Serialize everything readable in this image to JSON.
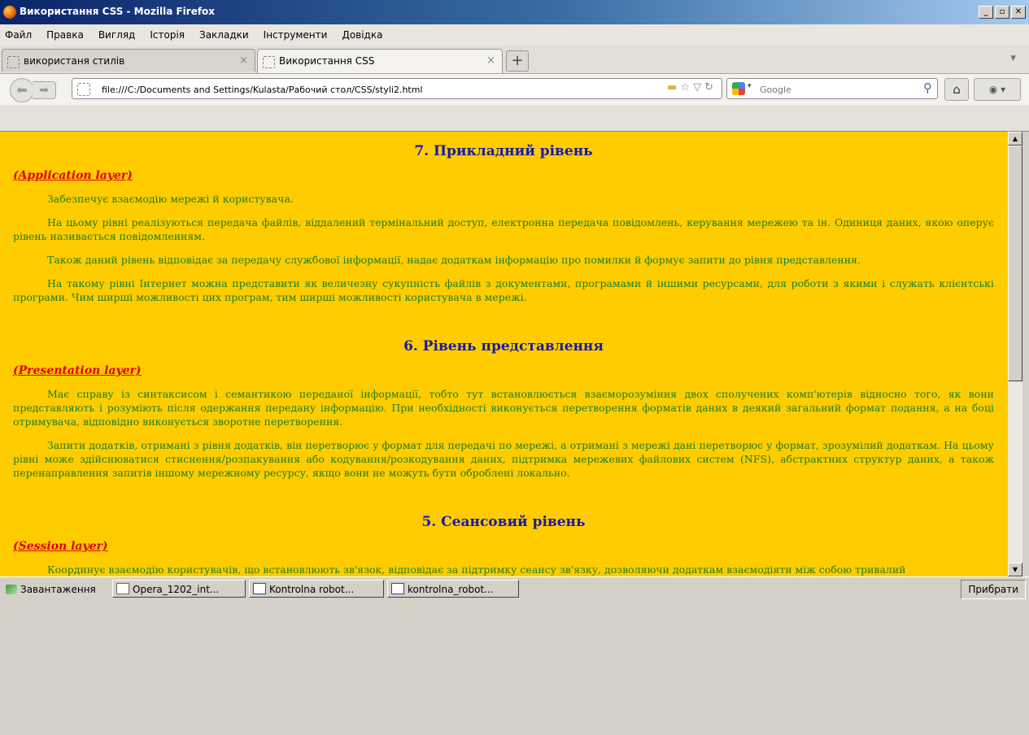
{
  "window": {
    "title": "Використання CSS - Mozilla Firefox",
    "controls": [
      "_",
      "▫",
      "✕"
    ]
  },
  "menu": [
    "Файл",
    "Правка",
    "Вигляд",
    "Історія",
    "Закладки",
    "Інструменти",
    "Довідка"
  ],
  "tabs": [
    {
      "label": "використаня стилів",
      "close": "×"
    },
    {
      "label": "Використання CSS",
      "close": "×"
    }
  ],
  "new_tab": "+",
  "address": {
    "url": "file:///C:/Documents and Settings/Kulasta/Рабочий стол/CSS/styli2.html"
  },
  "search": {
    "placeholder": "Google"
  },
  "content": {
    "sections": [
      {
        "heading": "7. Прикладний рівень",
        "layer": "(Application layer)",
        "paragraphs": [
          "Забезпечує взаємодію мережі й користувача.",
          "На цьому рівні реалізуються передача файлів, віддалений термінальний доступ, електронна передача повідомлень, керування мережею та ін. Одиниця даних, якою оперує рівень називається повідомленням.",
          "Також даний рівень відповідає за передачу службової інформації, надає додаткам інформацію про помилки й формує запити до рівня представлення.",
          "На такому рівні Інтернет можна представити як величезну сукупність файлів з документами, програмами й іншими ресурсами, для роботи з якими і служать клієнтські програми. Чим ширші можливості цих програм, тим ширші можливості користувача в мережі."
        ]
      },
      {
        "heading": "6. Рівень представлення",
        "layer": "(Presentation layer)",
        "paragraphs": [
          "Має справу із синтаксисом і семантикою переданої інформації, тобто тут встановлюється взаєморозуміння двох сполучених комп'ютерів відносно того, як вони представляють і розуміють після одержання передану інформацію. При необхідності виконується перетворення форматів даних в деякий загальний формат подання, а на боці отримувача, відповідно виконується зворотне перетворення.",
          "Запити додатків, отримані з рівня додатків, він перетворює у формат для передачі по мережі, а отримані з мережі дані перетворює у формат, зрозумілий додаткам. На цьому рівні може здійснюватися стиснення/розпакування або кодування/розкодування даних, підтримка мережевих файлових систем (NFS), абстрактних структур даних, а також перенаправлення запитів іншому мережному ресурсу, якщо вони не можуть бути оброблені локально."
        ]
      },
      {
        "heading": "5. Сеансовий рівень",
        "layer": "(Session layer)",
        "paragraphs": [
          "Координує взаємодію користувачів, що встановлюють зв'язок, відповідає за підтримку сеансу зв'язку, дозволяючи додаткам взаємодіяти між собою тривалий"
        ]
      }
    ]
  },
  "taskbar": {
    "items": [
      "Завантаження",
      "Opera_1202_int...",
      "Kontrolna robot...",
      "kontrolna_robot..."
    ],
    "hide": "Прибрати"
  },
  "colors": {
    "content_bg": "#ffcc00",
    "heading": "#1a1aa6",
    "layer": "#e00000",
    "text": "#1f7f1f"
  }
}
